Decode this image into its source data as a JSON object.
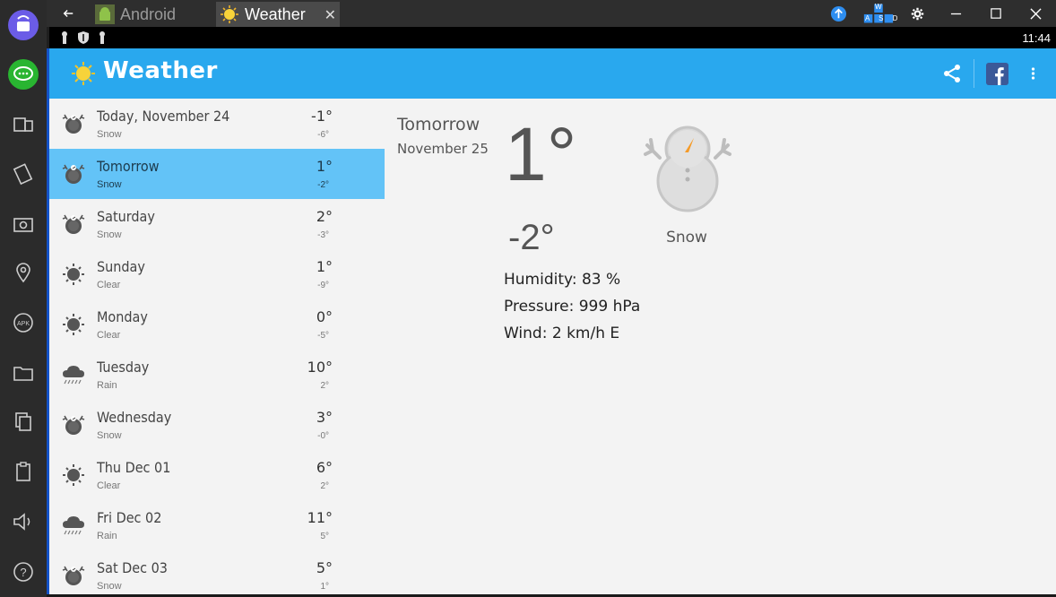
{
  "window": {
    "tabs": [
      {
        "label": "Android",
        "icon": "android-icon"
      },
      {
        "label": "Weather",
        "icon": "sun-icon",
        "close": "✕"
      }
    ]
  },
  "statusbar": {
    "time": "11:44"
  },
  "app": {
    "title": "Weather",
    "accent": "#29a8ee",
    "selected_color": "#63c3f7"
  },
  "forecast": [
    {
      "day": "Today, November 24",
      "cond": "Snow",
      "hi": "-1°",
      "lo": "-6°",
      "icon": "snow-icon"
    },
    {
      "day": "Tomorrow",
      "cond": "Snow",
      "hi": "1°",
      "lo": "-2°",
      "icon": "snow-icon"
    },
    {
      "day": "Saturday",
      "cond": "Snow",
      "hi": "2°",
      "lo": "-3°",
      "icon": "snow-icon"
    },
    {
      "day": "Sunday",
      "cond": "Clear",
      "hi": "1°",
      "lo": "-9°",
      "icon": "clear-icon"
    },
    {
      "day": "Monday",
      "cond": "Clear",
      "hi": "0°",
      "lo": "-5°",
      "icon": "clear-icon"
    },
    {
      "day": "Tuesday",
      "cond": "Rain",
      "hi": "10°",
      "lo": "2°",
      "icon": "rain-icon"
    },
    {
      "day": "Wednesday",
      "cond": "Snow",
      "hi": "3°",
      "lo": "-0°",
      "icon": "snow-icon"
    },
    {
      "day": "Thu Dec 01",
      "cond": "Clear",
      "hi": "6°",
      "lo": "2°",
      "icon": "clear-icon"
    },
    {
      "day": "Fri Dec 02",
      "cond": "Rain",
      "hi": "11°",
      "lo": "5°",
      "icon": "rain-icon"
    },
    {
      "day": "Sat Dec 03",
      "cond": "Snow",
      "hi": "5°",
      "lo": "1°",
      "icon": "snow-icon"
    }
  ],
  "detail": {
    "day": "Tomorrow",
    "date": "November 25",
    "hi": "1°",
    "lo": "-2°",
    "cond": "Snow",
    "humidity": "Humidity: 83 %",
    "pressure": "Pressure: 999 hPa",
    "wind": "Wind: 2 km/h E",
    "icon": "snowman-icon"
  },
  "keyboard_badge": {
    "top": "W",
    "bottom": "A S D"
  }
}
